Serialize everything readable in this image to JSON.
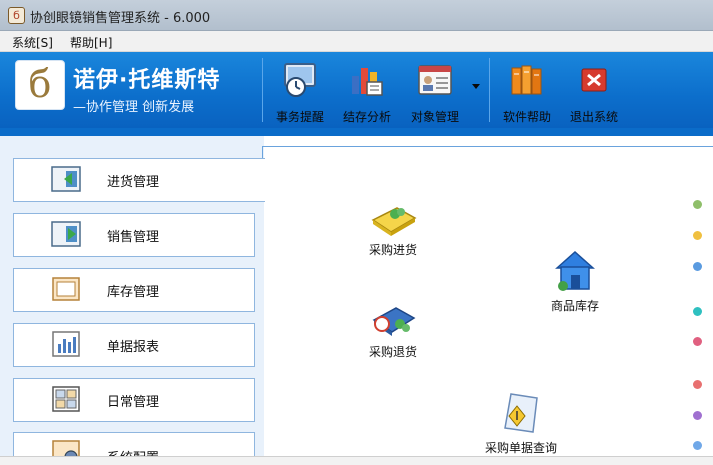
{
  "window": {
    "title": "协创眼镜销售管理系统 - 6.000",
    "app_icon": "app-icon"
  },
  "menu": [
    {
      "label": "系统[S]"
    },
    {
      "label": "帮助[H]"
    }
  ],
  "brand": {
    "name": "诺伊·托维斯特",
    "slogan": "—协作管理 创新发展",
    "logo_mark": "б"
  },
  "toolbar": [
    {
      "label": "事务提醒",
      "icon": "clock-reminder-icon"
    },
    {
      "label": "结存分析",
      "icon": "bar-chart-analysis-icon"
    },
    {
      "label": "对象管理",
      "icon": "contact-card-icon"
    },
    {
      "label": "软件帮助",
      "icon": "books-help-icon"
    },
    {
      "label": "退出系统",
      "icon": "exit-x-icon"
    }
  ],
  "sidebar": [
    {
      "label": "进货管理",
      "icon": "inbound-icon",
      "active": true
    },
    {
      "label": "销售管理",
      "icon": "sales-icon"
    },
    {
      "label": "库存管理",
      "icon": "inventory-icon"
    },
    {
      "label": "单据报表",
      "icon": "report-chart-icon"
    },
    {
      "label": "日常管理",
      "icon": "daily-grid-icon"
    },
    {
      "label": "系统配置",
      "icon": "config-gear-icon"
    }
  ],
  "main": [
    {
      "label": "采购进货",
      "icon": "purchase-notebook-icon"
    },
    {
      "label": "商品库存",
      "icon": "warehouse-house-icon"
    },
    {
      "label": "采购退货",
      "icon": "purchase-return-icon"
    },
    {
      "label": "采购单据查询",
      "icon": "document-query-icon"
    }
  ],
  "status_dot_colors": [
    "#8fbf6a",
    "#f0c040",
    "#5a9be0",
    "#2fc0c0",
    "#e06080",
    "#e87070",
    "#a070d0",
    "#70a8e8"
  ]
}
